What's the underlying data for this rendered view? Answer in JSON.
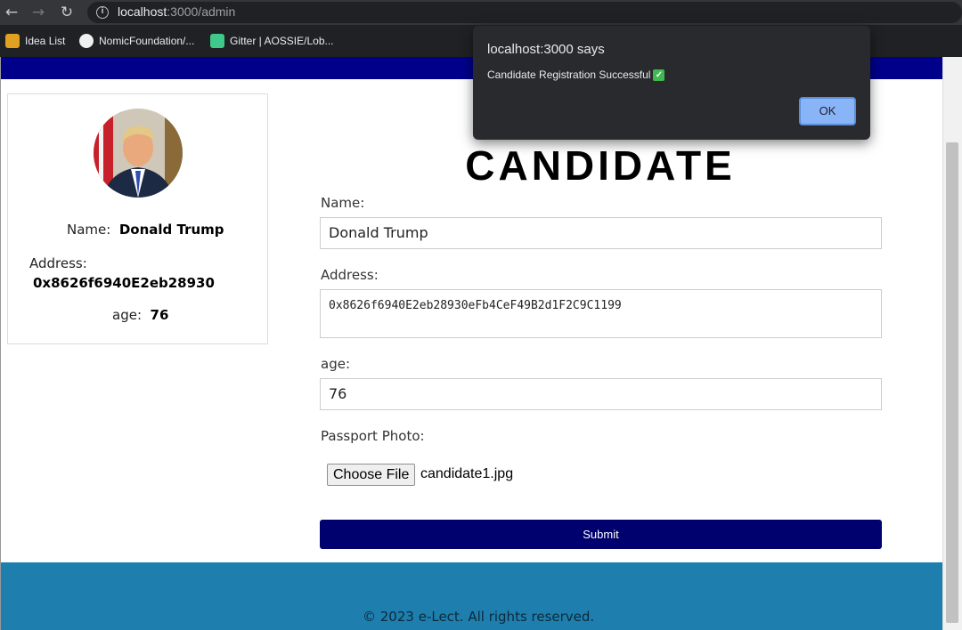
{
  "browser": {
    "url_host": "localhost",
    "url_rest": ":3000/admin",
    "bookmarks": [
      {
        "label": "Idea List"
      },
      {
        "label": "NomicFoundation/..."
      },
      {
        "label": "Gitter | AOSSIE/Lob..."
      }
    ]
  },
  "dialog": {
    "title": "localhost:3000 says",
    "message": "Candidate Registration Successful",
    "ok_label": "OK"
  },
  "card": {
    "name_label": "Name:",
    "name_value": "Donald Trump",
    "address_label": "Address:",
    "address_value": "0x8626f6940E2eb28930",
    "age_label": "age:",
    "age_value": "76"
  },
  "form": {
    "title": "CANDIDATE",
    "name_label": "Name:",
    "name_value": "Donald Trump",
    "address_label": "Address:",
    "address_value": "0x8626f6940E2eb28930eFb4CeF49B2d1F2C9C1199",
    "age_label": "age:",
    "age_value": "76",
    "photo_label": "Passport Photo:",
    "choose_file_label": "Choose File",
    "file_name": "candidate1.jpg",
    "submit_label": "Submit"
  },
  "footer": {
    "text": "© 2023 e-Lect. All rights reserved."
  },
  "colors": {
    "navbar": "#00008b",
    "submit": "#00006e",
    "footer": "#1e7fae"
  }
}
